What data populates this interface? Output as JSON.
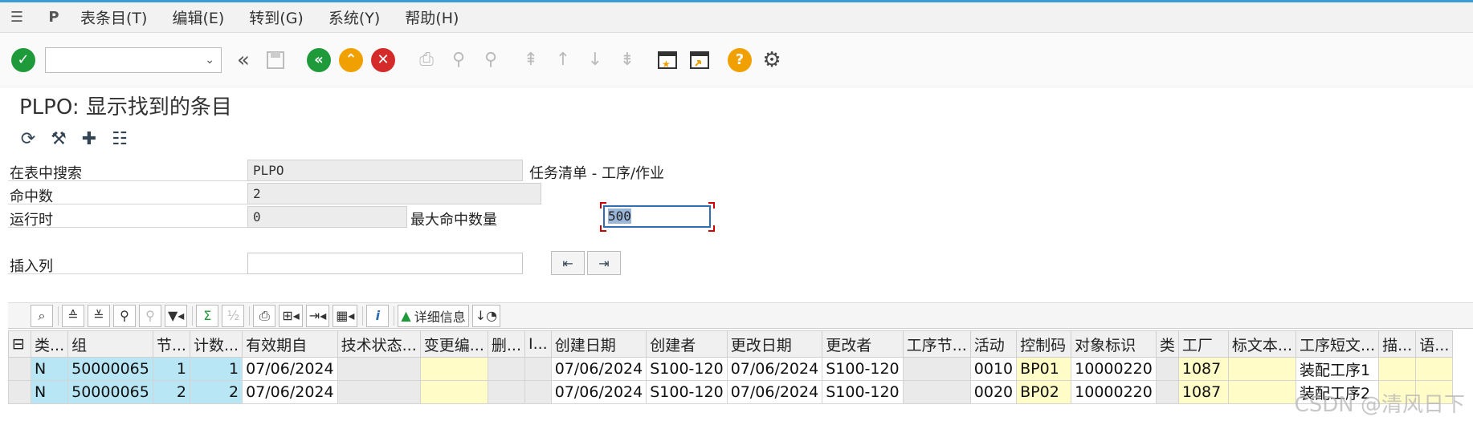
{
  "menu": [
    "表条目(T)",
    "编辑(E)",
    "转到(G)",
    "系统(Y)",
    "帮助(H)"
  ],
  "title": "PLPO: 显示找到的条目",
  "form": {
    "search_label": "在表中搜索",
    "search_value": "PLPO",
    "search_desc": "任务清单 - 工序/作业",
    "hits_label": "命中数",
    "hits_value": "2",
    "runtime_label": "运行时",
    "runtime_value": "0",
    "maxhits_label": "最大命中数量",
    "maxhits_value": "500",
    "insert_label": "插入列"
  },
  "grid_toolbar": {
    "sum": "Σ",
    "info": "i",
    "detail_label": "详细信息"
  },
  "columns": [
    "类...",
    "组",
    "节...",
    "计数...",
    "有效期自",
    "技术状态...",
    "变更编...",
    "删...",
    "I...",
    "创建日期",
    "创建者",
    "更改日期",
    "更改者",
    "工序节...",
    "活动",
    "控制码",
    "对象标识",
    "类",
    "工厂",
    "标文本...",
    "工序短文...",
    "描...",
    "语..."
  ],
  "rows": [
    [
      "N",
      "50000065",
      "1",
      "1",
      "07/06/2024",
      "",
      "",
      "",
      "",
      "07/06/2024",
      "S100-120",
      "07/06/2024",
      "S100-120",
      "",
      "0010",
      "BP01",
      "10000220",
      "",
      "1087",
      "",
      "装配工序1",
      "",
      ""
    ],
    [
      "N",
      "50000065",
      "2",
      "2",
      "07/06/2024",
      "",
      "",
      "",
      "",
      "07/06/2024",
      "S100-120",
      "07/06/2024",
      "S100-120",
      "",
      "0020",
      "BP02",
      "10000220",
      "",
      "1087",
      "",
      "装配工序2",
      "",
      ""
    ]
  ],
  "watermark": "CSDN @清风日下",
  "colors": {
    "accent": "#3a9bd9",
    "green": "#1f9a3a",
    "orange": "#f0a000",
    "red": "#d42a2a",
    "key_cell": "#b8e6f5",
    "yellow_cell": "#fffcc8"
  }
}
